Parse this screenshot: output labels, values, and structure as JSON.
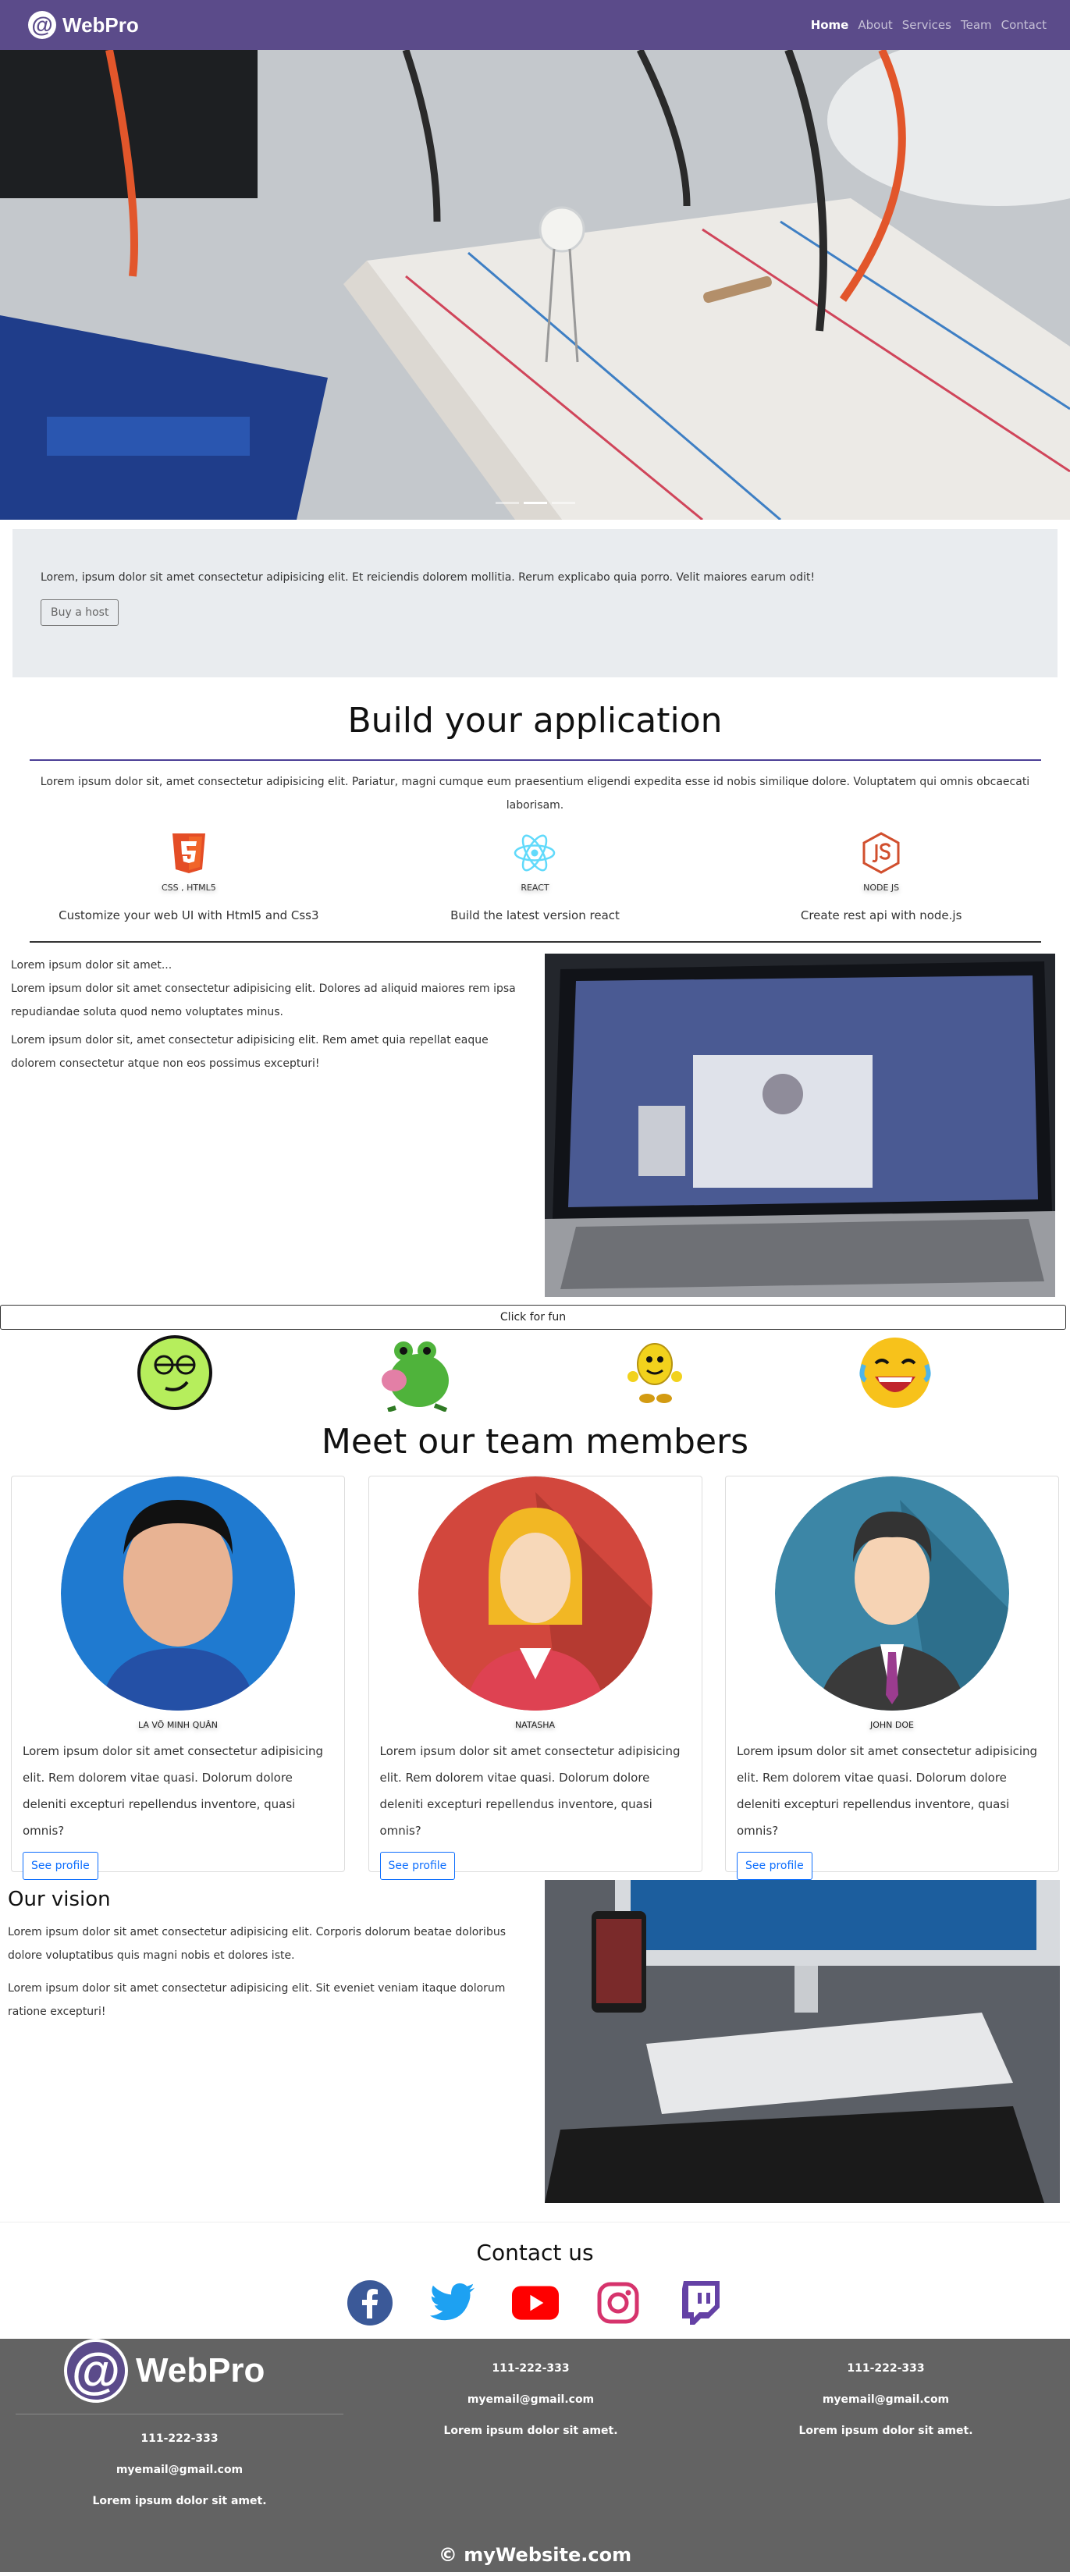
{
  "nav": {
    "brand": "WebPro",
    "brand_symbol": "@",
    "links": [
      "Home",
      "About",
      "Services",
      "Team",
      "Contact"
    ]
  },
  "jumbotron": {
    "text": "Lorem, ipsum dolor sit amet consectetur adipisicing elit. Et reiciendis dolorem mollitia. Rerum explicabo quia porro. Velit maiores earum odit!",
    "button": "Buy a host"
  },
  "build": {
    "title": "Build your application",
    "text": "Lorem ipsum dolor sit, amet consectetur adipisicing elit. Pariatur, magni cumque eum praesentium eligendi expedita esse id nobis similique dolore. Voluptatem qui omnis obcaecati laborisam.",
    "features": [
      {
        "label": "CSS , HTML5",
        "desc": "Customize your web UI with Html5 and Css3",
        "icon": "html5-icon"
      },
      {
        "label": "REACT",
        "desc": "Build the latest version react",
        "icon": "react-icon"
      },
      {
        "label": "NODE JS",
        "desc": "Create rest api with node.js",
        "icon": "nodejs-icon"
      }
    ]
  },
  "about": {
    "p1": "Lorem ipsum dolor sit amet...",
    "p2": "Lorem ipsum dolor sit amet consectetur adipisicing elit. Dolores ad aliquid maiores rem ipsa repudiandae soluta quod nemo voluptates minus.",
    "p3": "Lorem ipsum dolor sit, amet consectetur adipisicing elit. Rem amet quia repellat eaque dolorem consectetur atque non eos possimus excepturi!"
  },
  "fun_button": "Click for fun",
  "team": {
    "title": "Meet our team members",
    "members": [
      {
        "name": "LA VÕ MINH QUÂN",
        "text": "Lorem ipsum dolor sit amet consectetur adipisicing elit. Rem dolorem vitae quasi. Dolorum dolore deleniti excepturi repellendus inventore, quasi omnis?",
        "button": "See profile"
      },
      {
        "name": "NATASHA",
        "text": "Lorem ipsum dolor sit amet consectetur adipisicing elit. Rem dolorem vitae quasi. Dolorum dolore deleniti excepturi repellendus inventore, quasi omnis?",
        "button": "See profile"
      },
      {
        "name": "JOHN DOE",
        "text": "Lorem ipsum dolor sit amet consectetur adipisicing elit. Rem dolorem vitae quasi. Dolorum dolore deleniti excepturi repellendus inventore, quasi omnis?",
        "button": "See profile"
      }
    ]
  },
  "vision": {
    "title": "Our vision",
    "p1": "Lorem ipsum dolor sit amet consectetur adipisicing elit. Corporis dolorum beatae doloribus dolore voluptatibus quis magni nobis et dolores iste.",
    "p2": "Lorem ipsum dolor sit amet consectetur adipisicing elit. Sit eveniet veniam itaque dolorum ratione excepturi!"
  },
  "contact": {
    "title": "Contact us",
    "socials": [
      "facebook-icon",
      "twitter-icon",
      "youtube-icon",
      "instagram-icon",
      "twitch-icon"
    ]
  },
  "footer": {
    "brand": "WebPro",
    "phone": "111-222-333",
    "email": "myemail@gmail.com",
    "address": "Lorem ipsum dolor sit amet.",
    "copyright": "myWebsite.com",
    "copyright_symbol": "©"
  },
  "colors": {
    "nav_bg": "#5b4b8a",
    "footer_bg": "#636363",
    "accent_purple": "#4b3f96",
    "profile_button": "#0d6efd"
  }
}
